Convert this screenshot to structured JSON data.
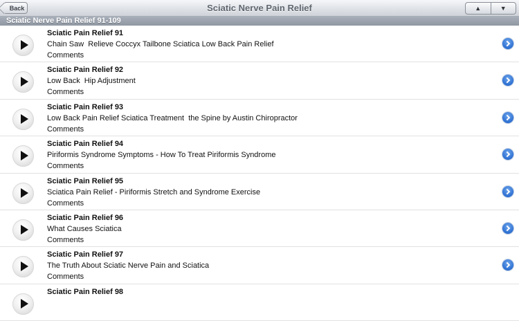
{
  "navbar": {
    "back_label": "Back",
    "title": "Sciatic Nerve Pain Relief",
    "up_glyph": "▲",
    "down_glyph": "▼"
  },
  "section": {
    "header": "Sciatic Nerve Pain Relief 91-109"
  },
  "items": [
    {
      "title": "Sciatic Pain Relief 91",
      "description": "Chain Saw  Relieve Coccyx Tailbone Sciatica Low Back Pain Relief",
      "comments": "Comments"
    },
    {
      "title": "Sciatic Pain Relief 92",
      "description": "Low Back  Hip Adjustment",
      "comments": "Comments"
    },
    {
      "title": "Sciatic Pain Relief 93",
      "description": "Low Back Pain Relief Sciatica Treatment  the Spine by Austin Chiropractor",
      "comments": "Comments"
    },
    {
      "title": "Sciatic Pain Relief 94",
      "description": "Piriformis Syndrome Symptoms - How To Treat Piriformis Syndrome",
      "comments": "Comments"
    },
    {
      "title": "Sciatic Pain Relief 95",
      "description": "Sciatica Pain Relief - Piriformis Stretch and Syndrome Exercise",
      "comments": "Comments"
    },
    {
      "title": "Sciatic Pain Relief 96",
      "description": "What Causes Sciatica",
      "comments": "Comments"
    },
    {
      "title": "Sciatic Pain Relief 97",
      "description": "The Truth About Sciatic Nerve Pain and Sciatica",
      "comments": "Comments"
    },
    {
      "title": "Sciatic Pain Relief 98",
      "description": "",
      "comments": ""
    }
  ],
  "icons": {
    "play": "play-icon",
    "disclosure": "disclosure-chevron-icon"
  },
  "colors": {
    "disclosure_blue": "#2c6fd2",
    "section_header": "#98a0ab"
  }
}
